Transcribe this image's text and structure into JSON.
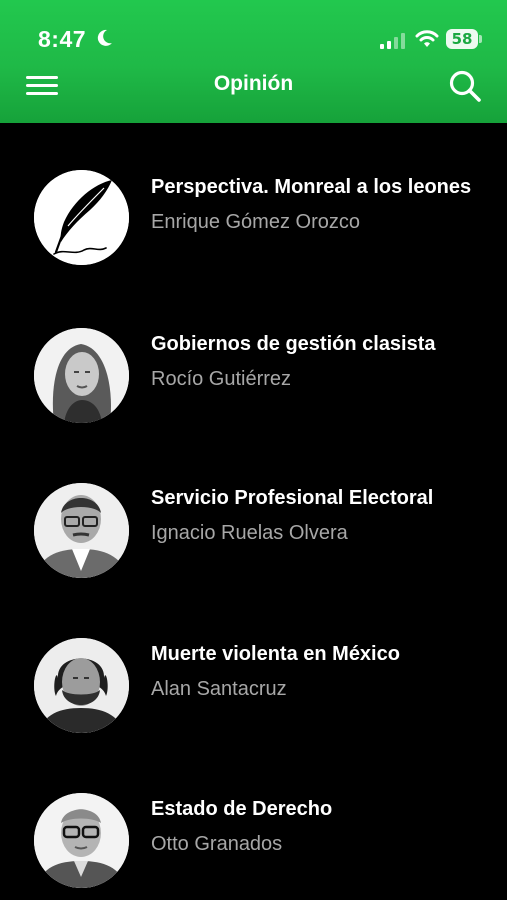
{
  "status_bar": {
    "time": "8:47",
    "battery": "58"
  },
  "nav": {
    "title": "Opinión"
  },
  "articles": [
    {
      "title": "Perspectiva. Monreal a los leones",
      "author": "Enrique Gómez Orozco",
      "avatar": "quill-logo"
    },
    {
      "title": "Gobiernos de gestión clasista",
      "author": "Rocío Gutiérrez",
      "avatar": "author-photo"
    },
    {
      "title": "Servicio Profesional Electoral",
      "author": "Ignacio Ruelas Olvera",
      "avatar": "author-photo"
    },
    {
      "title": "Muerte violenta en México",
      "author": "Alan Santacruz",
      "avatar": "author-photo"
    },
    {
      "title": "Estado de Derecho",
      "author": "Otto Granados",
      "avatar": "author-photo"
    }
  ],
  "colors": {
    "header_green": "#1fb947",
    "background": "#000000",
    "author_gray": "#a7a7a7"
  }
}
